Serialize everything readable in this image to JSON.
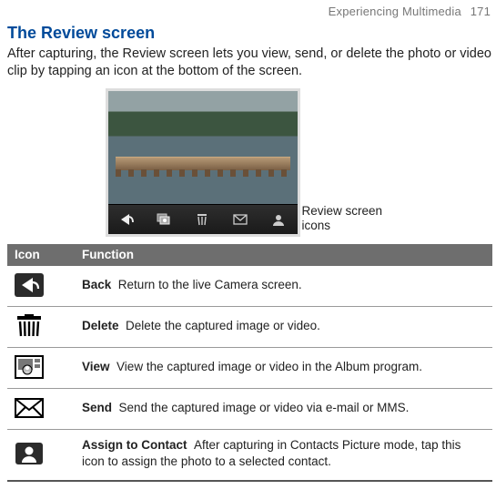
{
  "header": {
    "chapter": "Experiencing Multimedia",
    "page_number": "171"
  },
  "section": {
    "title": "The Review screen",
    "intro": "After capturing, the Review screen lets you view, send, or delete the photo or video clip by tapping an icon at the bottom of the screen."
  },
  "screenshot": {
    "caption": "Review screen icons",
    "toolbar_icons": [
      "back",
      "view",
      "delete",
      "send",
      "assign-to-contact"
    ]
  },
  "table": {
    "headers": {
      "icon": "Icon",
      "function": "Function"
    },
    "rows": [
      {
        "icon": "back",
        "name": "Back",
        "desc": "Return to the live Camera screen."
      },
      {
        "icon": "delete",
        "name": "Delete",
        "desc": "Delete the captured image or video."
      },
      {
        "icon": "view",
        "name": "View",
        "desc": "View the captured image or video in the Album program."
      },
      {
        "icon": "send",
        "name": "Send",
        "desc": "Send the captured image or video via e-mail or MMS."
      },
      {
        "icon": "assign-to-contact",
        "name": "Assign to Contact",
        "desc": "After capturing in Contacts Picture mode, tap this icon to assign the photo to a selected contact."
      }
    ]
  }
}
